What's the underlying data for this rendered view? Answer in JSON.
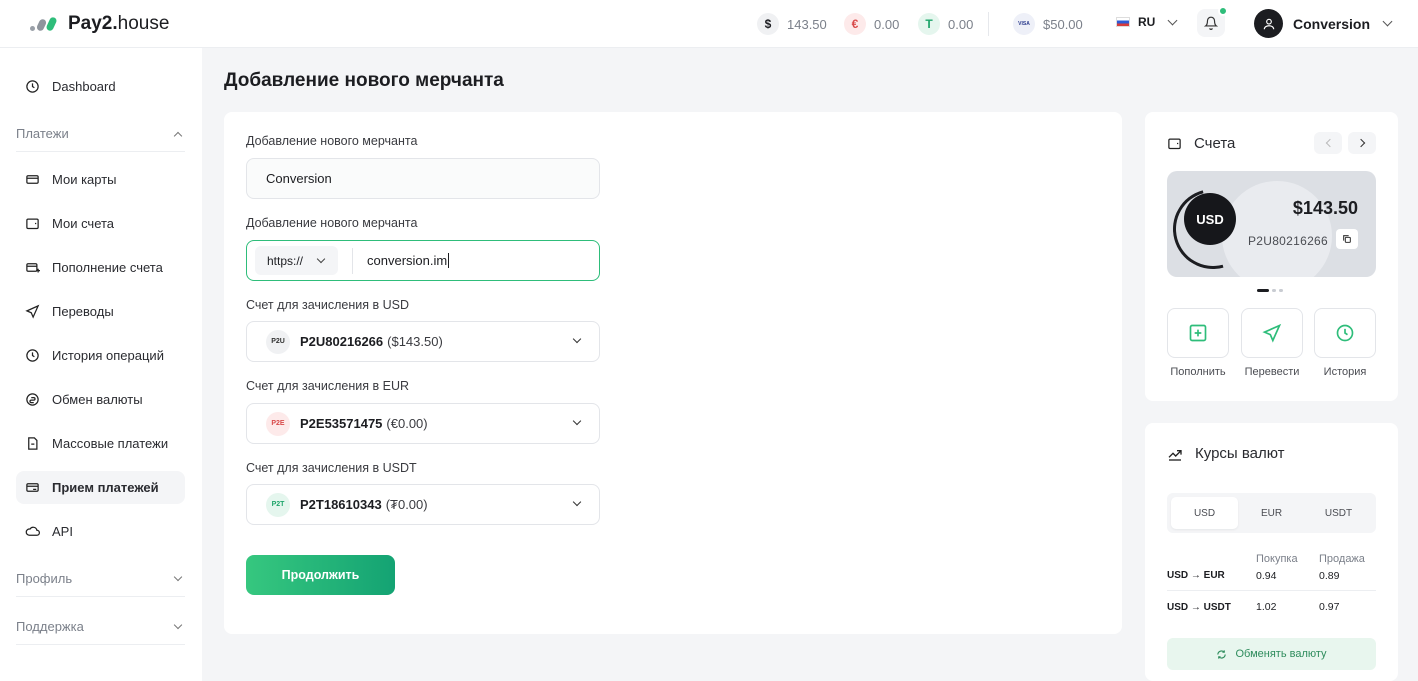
{
  "header": {
    "logo_bold": "Pay2.",
    "logo_light": "house",
    "balances": [
      {
        "symbol": "$",
        "value": "143.50"
      },
      {
        "symbol": "€",
        "value": "0.00"
      },
      {
        "symbol": "T",
        "value": "0.00"
      }
    ],
    "card_label": "VISA",
    "card_balance": "$50.00",
    "language": "RU",
    "user_name": "Conversion"
  },
  "sidebar": {
    "dashboard": "Dashboard",
    "section_payments": "Платежи",
    "items": [
      "Мои карты",
      "Мои счета",
      "Пополнение счета",
      "Переводы",
      "История операций",
      "Обмен валюты",
      "Массовые платежи",
      "Прием платежей",
      "API"
    ],
    "section_profile": "Профиль",
    "section_support": "Поддержка"
  },
  "main": {
    "title": "Добавление нового мерчанта",
    "name_label": "Добавление нового мерчанта",
    "name_value": "Conversion",
    "url_label": "Добавление нового мерчанта",
    "protocol": "https://",
    "url_value": "conversion.im",
    "usd_label": "Счет для зачисления в USD",
    "usd_badge": "P2U",
    "usd_account": "P2U80216266",
    "usd_balance": "($143.50)",
    "eur_label": "Счет для зачисления в EUR",
    "eur_badge": "P2E",
    "eur_account": "P2E53571475",
    "eur_balance": "(€0.00)",
    "usdt_label": "Счет для зачисления в USDT",
    "usdt_badge": "P2T",
    "usdt_account": "P2T18610343",
    "usdt_balance": "(₮0.00)",
    "continue": "Продолжить"
  },
  "accounts_panel": {
    "title": "Счета",
    "currency": "USD",
    "amount": "$143.50",
    "number": "P2U80216266",
    "actions": [
      "Пополнить",
      "Перевести",
      "История"
    ]
  },
  "rates_panel": {
    "title": "Курсы валют",
    "tabs": [
      "USD",
      "EUR",
      "USDT"
    ],
    "col_buy": "Покупка",
    "col_sell": "Продажа",
    "rows": [
      {
        "pair": "USD → EUR",
        "buy": "0.94",
        "sell": "0.89"
      },
      {
        "pair": "USD → USDT",
        "buy": "1.02",
        "sell": "0.97"
      }
    ],
    "exchange_button": "Обменять валюту"
  },
  "colors": {
    "accent": "#2ebd7a",
    "usd_coin_bg": "#f0f1f3",
    "eur_coin_bg": "#fdeaea",
    "usdt_coin_bg": "#e5f6ee"
  }
}
